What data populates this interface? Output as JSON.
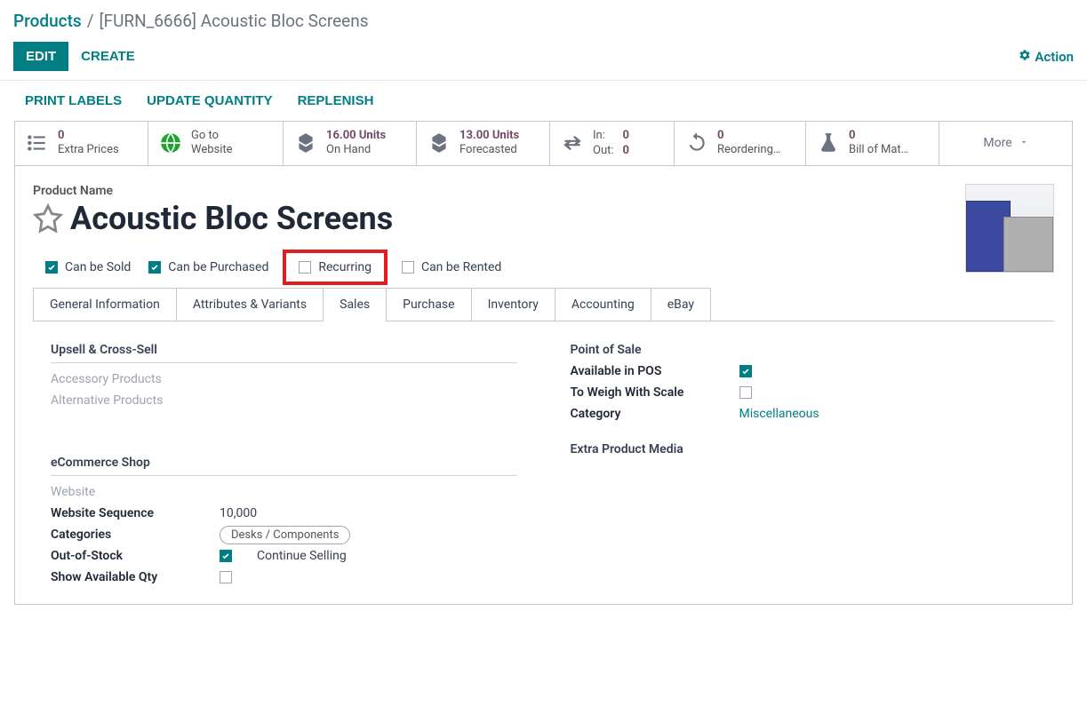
{
  "breadcrumb": {
    "root": "Products",
    "sep": "/",
    "current": "[FURN_6666] Acoustic Bloc Screens"
  },
  "actions": {
    "edit": "EDIT",
    "create": "CREATE",
    "gear": "Action"
  },
  "subtoolbar": {
    "print": "PRINT LABELS",
    "update_qty": "UPDATE QUANTITY",
    "replenish": "REPLENISH"
  },
  "stats": {
    "extra": {
      "value": "0",
      "label": "Extra Prices"
    },
    "website": {
      "value": "Go to",
      "label": "Website"
    },
    "onhand": {
      "value": "16.00 Units",
      "label": "On Hand"
    },
    "forecast": {
      "value": "13.00 Units",
      "label": "Forecasted"
    },
    "inout": {
      "in_label": "In:",
      "in_value": "0",
      "out_label": "Out:",
      "out_value": "0"
    },
    "reorder": {
      "value": "0",
      "label": "Reordering…"
    },
    "bom": {
      "value": "0",
      "label": "Bill of Mat…"
    },
    "more": "More"
  },
  "product": {
    "name_label": "Product Name",
    "name": "Acoustic Bloc Screens",
    "checks": {
      "sold": {
        "label": "Can be Sold",
        "checked": true
      },
      "purchased": {
        "label": "Can be Purchased",
        "checked": true
      },
      "recurring": {
        "label": "Recurring",
        "checked": false
      },
      "rented": {
        "label": "Can be Rented",
        "checked": false
      }
    }
  },
  "tabs": [
    "General Information",
    "Attributes & Variants",
    "Sales",
    "Purchase",
    "Inventory",
    "Accounting",
    "eBay"
  ],
  "active_tab": "Sales",
  "sales": {
    "upsell_title": "Upsell & Cross-Sell",
    "accessory_label": "Accessory Products",
    "alternative_label": "Alternative Products",
    "ecom_title": "eCommerce Shop",
    "website_label": "Website",
    "website_sequence_label": "Website Sequence",
    "website_sequence_value": "10,000",
    "categories_label": "Categories",
    "categories_value": "Desks / Components",
    "oos_label": "Out-of-Stock",
    "oos_continue": "Continue Selling",
    "oos_checked": true,
    "show_qty_label": "Show Available Qty",
    "show_qty_checked": false,
    "pos_title": "Point of Sale",
    "available_pos_label": "Available in POS",
    "available_pos_checked": true,
    "weigh_label": "To Weigh With Scale",
    "weigh_checked": false,
    "category_label": "Category",
    "category_value": "Miscellaneous",
    "epm_title": "Extra Product Media"
  }
}
